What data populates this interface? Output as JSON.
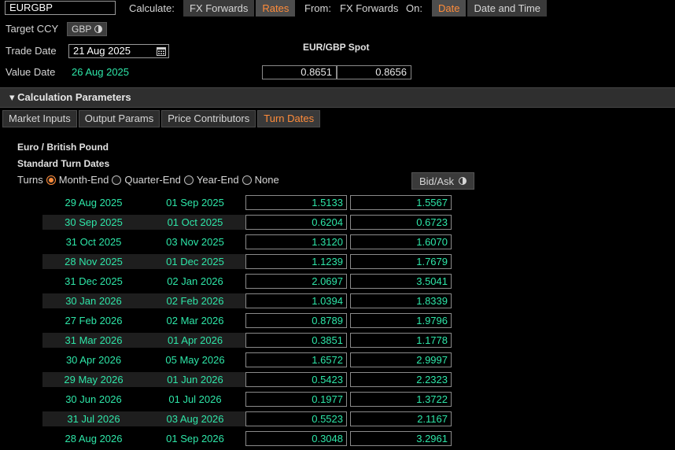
{
  "header": {
    "ticker": "EURGBP",
    "calculate_label": "Calculate:",
    "calculate_options": [
      "FX Forwards",
      "Rates"
    ],
    "from_label": "From:",
    "from_value": "FX Forwards",
    "on_label": "On:",
    "on_options": [
      "Date",
      "Date and Time"
    ]
  },
  "fields": {
    "target_ccy_label": "Target CCY",
    "target_ccy_value": "GBP",
    "trade_date_label": "Trade Date",
    "trade_date_value": "21 Aug 2025",
    "value_date_label": "Value Date",
    "value_date_value": "26 Aug 2025"
  },
  "spot": {
    "title": "EUR/GBP Spot",
    "bid": "0.8651",
    "ask": "0.8656"
  },
  "section": {
    "title": "▾ Calculation Parameters"
  },
  "tabs": [
    "Market Inputs",
    "Output Params",
    "Price Contributors",
    "Turn Dates"
  ],
  "turn_dates": {
    "pair_title": "Euro / British Pound",
    "subtitle": "Standard Turn Dates",
    "turns_label": "Turns",
    "options": [
      "Month-End",
      "Quarter-End",
      "Year-End",
      "None"
    ],
    "selected": "Month-End",
    "bidask_label": "Bid/Ask",
    "rows": [
      {
        "start": "29 Aug 2025",
        "end": "01 Sep 2025",
        "bid": "1.5133",
        "ask": "1.5567"
      },
      {
        "start": "30 Sep 2025",
        "end": "01 Oct 2025",
        "bid": "0.6204",
        "ask": "0.6723"
      },
      {
        "start": "31 Oct 2025",
        "end": "03 Nov 2025",
        "bid": "1.3120",
        "ask": "1.6070"
      },
      {
        "start": "28 Nov 2025",
        "end": "01 Dec 2025",
        "bid": "1.1239",
        "ask": "1.7679"
      },
      {
        "start": "31 Dec 2025",
        "end": "02 Jan 2026",
        "bid": "2.0697",
        "ask": "3.5041"
      },
      {
        "start": "30 Jan 2026",
        "end": "02 Feb 2026",
        "bid": "1.0394",
        "ask": "1.8339"
      },
      {
        "start": "27 Feb 2026",
        "end": "02 Mar 2026",
        "bid": "0.8789",
        "ask": "1.9796"
      },
      {
        "start": "31 Mar 2026",
        "end": "01 Apr 2026",
        "bid": "0.3851",
        "ask": "1.1778"
      },
      {
        "start": "30 Apr 2026",
        "end": "05 May 2026",
        "bid": "1.6572",
        "ask": "2.9997"
      },
      {
        "start": "29 May 2026",
        "end": "01 Jun 2026",
        "bid": "0.5423",
        "ask": "2.2323"
      },
      {
        "start": "30 Jun 2026",
        "end": "01 Jul 2026",
        "bid": "0.1977",
        "ask": "1.3722"
      },
      {
        "start": "31 Jul 2026",
        "end": "03 Aug 2026",
        "bid": "0.5523",
        "ask": "2.1167"
      },
      {
        "start": "28 Aug 2026",
        "end": "01 Sep 2026",
        "bid": "0.3048",
        "ask": "3.2961"
      }
    ]
  },
  "colors": {
    "accent": "#ff8c3a",
    "value_green": "#2ee6a8",
    "background": "#000000"
  }
}
